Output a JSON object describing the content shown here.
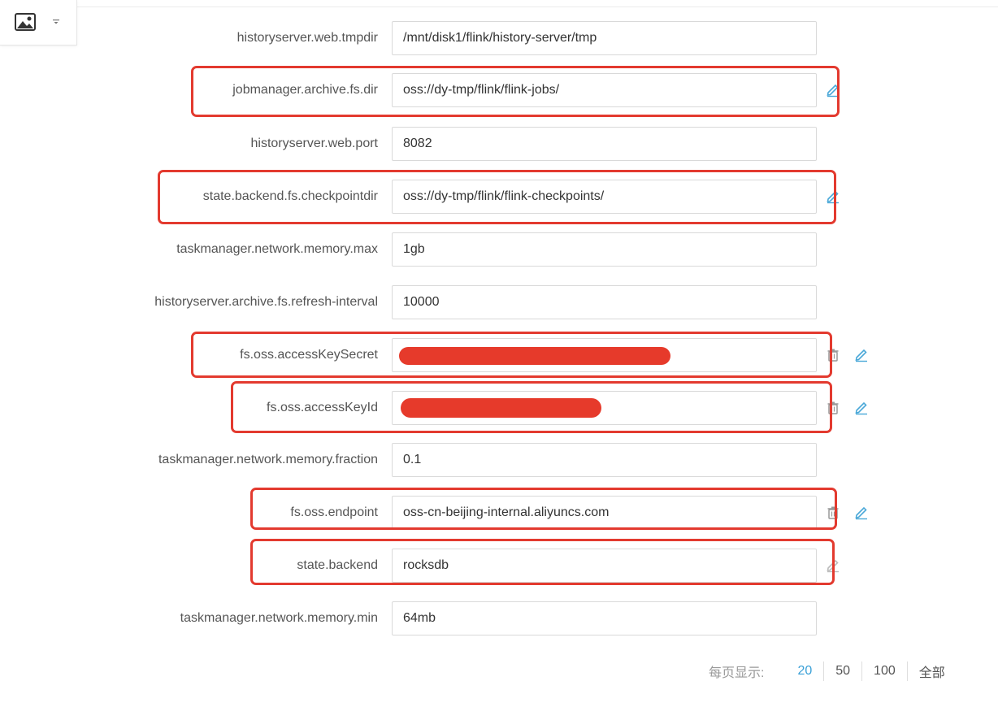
{
  "toolbar": {
    "image_button_icon": "image-icon",
    "caret_icon": "caret-down-icon"
  },
  "config_rows": [
    {
      "key": "historyserver.web.tmpdir",
      "value": "/mnt/disk1/flink/history-server/tmp",
      "highlighted": false
    },
    {
      "key": "jobmanager.archive.fs.dir",
      "value": "oss://dy-tmp/flink/flink-jobs/",
      "highlighted": true
    },
    {
      "key": "historyserver.web.port",
      "value": "8082",
      "highlighted": false
    },
    {
      "key": "state.backend.fs.checkpointdir",
      "value": "oss://dy-tmp/flink/flink-checkpoints/",
      "highlighted": true
    },
    {
      "key": "taskmanager.network.memory.max",
      "value": "1gb",
      "highlighted": false
    },
    {
      "key": "historyserver.archive.fs.refresh-interval",
      "value": "10000",
      "highlighted": false
    },
    {
      "key": "fs.oss.accessKeySecret",
      "value": "",
      "redacted": true,
      "highlighted": true
    },
    {
      "key": "fs.oss.accessKeyId",
      "value": "",
      "redacted": true,
      "highlighted": true
    },
    {
      "key": "taskmanager.network.memory.fraction",
      "value": "0.1",
      "highlighted": false
    },
    {
      "key": "fs.oss.endpoint",
      "value": "oss-cn-beijing-internal.aliyuncs.com",
      "highlighted": true
    },
    {
      "key": "state.backend",
      "value": "rocksdb",
      "highlighted": true
    },
    {
      "key": "taskmanager.network.memory.min",
      "value": "64mb",
      "highlighted": false
    }
  ],
  "pager": {
    "label": "每页显示:",
    "options": [
      "20",
      "50",
      "100",
      "全部"
    ],
    "selected": "20"
  },
  "colors": {
    "highlight": "#e33a2f",
    "redaction": "#e63a2b",
    "accent": "#3aa0d7"
  }
}
